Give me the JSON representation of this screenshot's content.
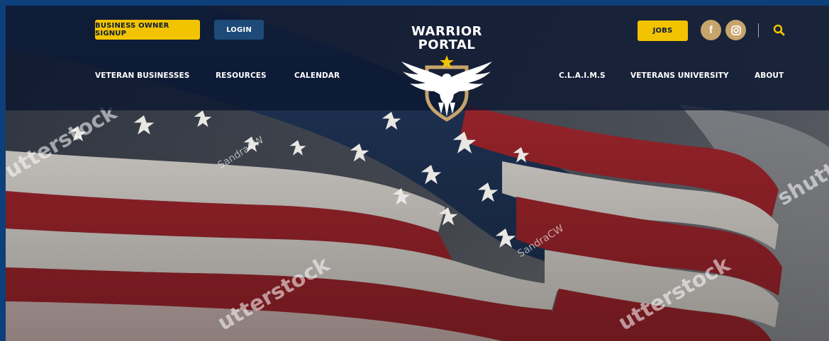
{
  "header": {
    "business_signup_label": "BUSINESS OWNER SIGNUP",
    "login_label": "LOGIN",
    "jobs_label": "JOBS",
    "logo_line1": "WARRIOR",
    "logo_line2": "PORTAL",
    "nav_left": [
      "VETERAN BUSINESSES",
      "RESOURCES",
      "CALENDAR"
    ],
    "nav_right": [
      "C.L.A.I.M.S",
      "VETERANS UNIVERSITY",
      "ABOUT"
    ]
  },
  "icons": {
    "facebook": "facebook-icon",
    "instagram": "instagram-icon",
    "search": "search-icon",
    "star": "star-icon",
    "eagle": "eagle-icon"
  },
  "colors": {
    "accent_yellow": "#f2c300",
    "header_navy": "#0a1630",
    "button_blue": "#1d4a78",
    "social_gold": "#c6a46b",
    "flag_red": "#a5262e",
    "flag_white": "#e6e1dc",
    "flag_blue": "#1f3457"
  }
}
